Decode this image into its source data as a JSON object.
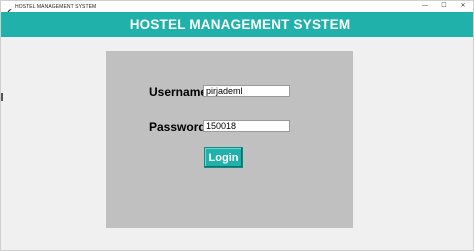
{
  "window": {
    "title": "HOSTEL MANAGEMENT SYSTEM",
    "controls": {
      "minimize": "—",
      "maximize": "☐",
      "close": "✕"
    }
  },
  "header": {
    "title": "HOSTEL MANAGEMENT SYSTEM"
  },
  "login_form": {
    "username_label": "Username",
    "username_value": "pirjademl",
    "password_label": "Password",
    "password_value": "150018",
    "login_button": "Login"
  },
  "colors": {
    "accent": "#20b2aa",
    "panel": "#c0c0c0",
    "background": "#f0f0f0"
  }
}
